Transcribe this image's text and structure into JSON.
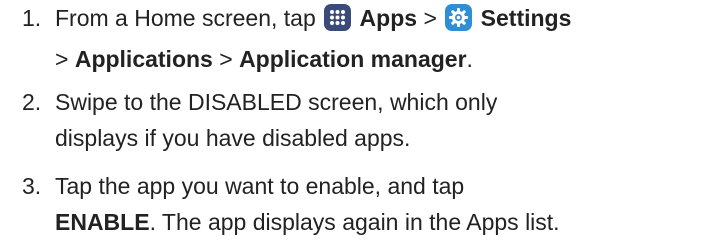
{
  "steps": [
    {
      "number": "1.",
      "text_start": "From a Home screen, tap",
      "apps_icon": "apps-grid-icon",
      "apps_label": "Apps",
      "sep1": ">",
      "settings_icon": "gear-icon",
      "settings_label": "Settings",
      "sep2": ">",
      "applications_label": "Applications",
      "sep3": ">",
      "app_manager_label": "Application manager",
      "end": "."
    },
    {
      "number": "2.",
      "line1": "Swipe to the DISABLED screen, which only",
      "line2": "displays if you have disabled apps."
    },
    {
      "number": "3.",
      "line1": "Tap the app you want to enable, and tap",
      "enable_label": "ENABLE",
      "line2_rest": ". The app displays again in the Apps list."
    }
  ],
  "colors": {
    "apps_icon_bg": "#3a4a7a",
    "settings_icon_bg": "#2e8fd6",
    "text": "#222222"
  }
}
